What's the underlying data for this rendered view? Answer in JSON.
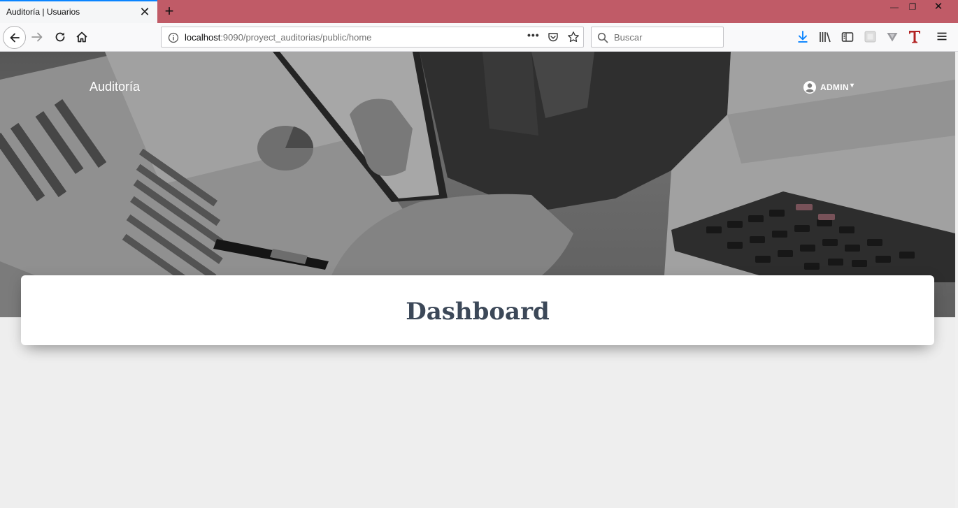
{
  "browser": {
    "tab_title": "Auditoría | Usuarios",
    "tab_close": "✕",
    "new_tab": "+",
    "window": {
      "minimize": "—",
      "restore": "❐",
      "close": "✕"
    },
    "url_host": "localhost",
    "url_rest": ":9090/proyect_auditorias/public/home",
    "url_more": "•••",
    "search_placeholder": "Buscar",
    "accent_color": "#0a84ff",
    "titlebar_color": "#c05b67"
  },
  "app": {
    "brand": "Auditoría",
    "user_name": "ADMIN",
    "user_caret": "▾",
    "page_title": "Dashboard",
    "title_color": "#3c4858"
  }
}
